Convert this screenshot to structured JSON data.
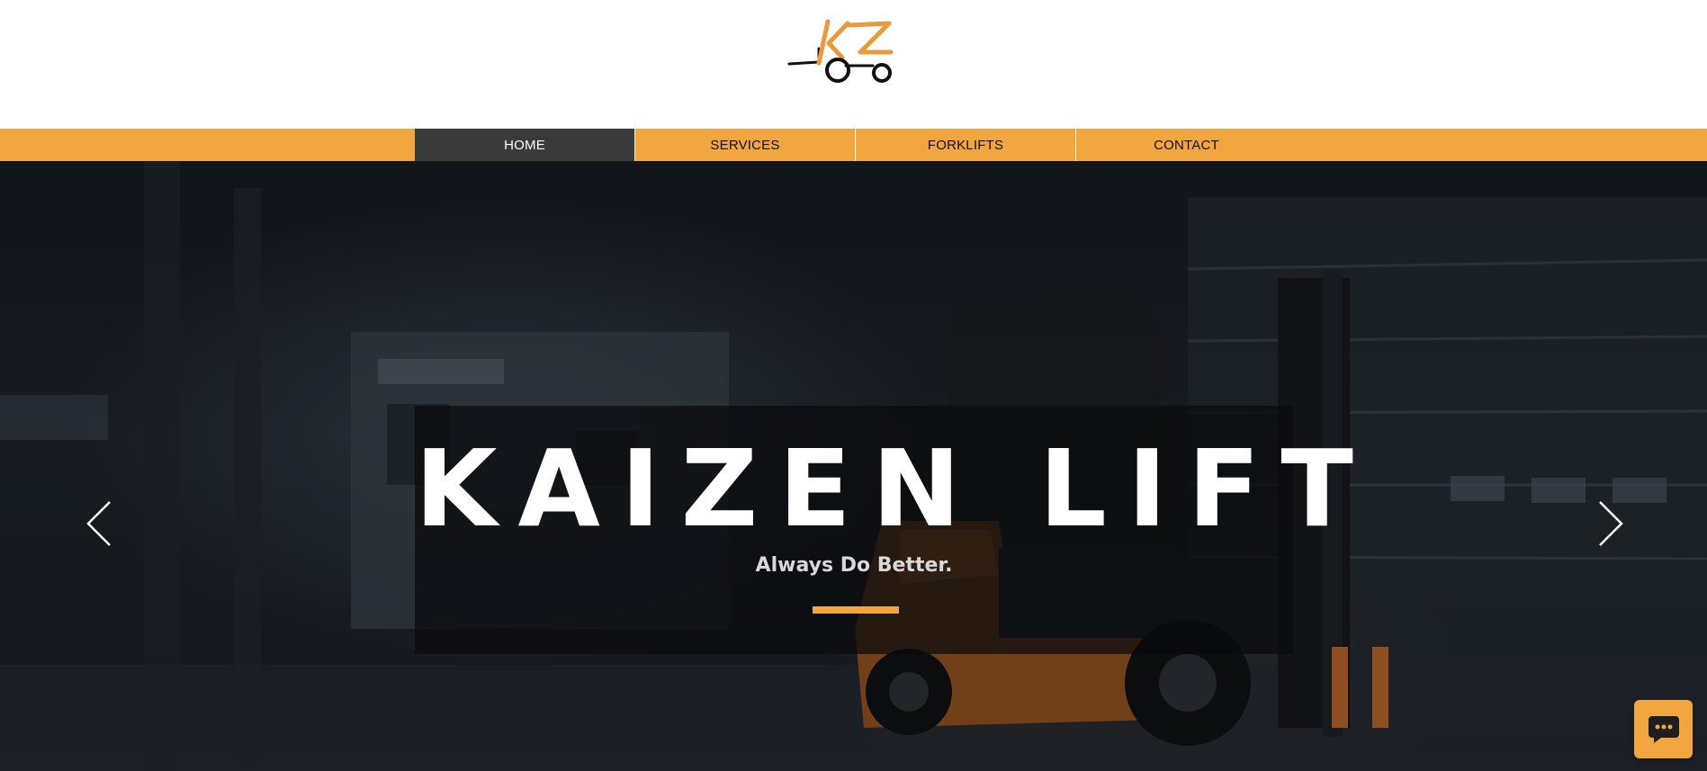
{
  "brand": {
    "logo_icon": "forklift-kz-logo-icon",
    "accent_color": "#f1a640"
  },
  "nav": {
    "items": [
      {
        "label": "HOME",
        "active": true
      },
      {
        "label": "SERVICES",
        "active": false
      },
      {
        "label": "FORKLIFTS",
        "active": false
      },
      {
        "label": "CONTACT",
        "active": false
      }
    ]
  },
  "hero": {
    "title": "KAIZEN LIFT",
    "subtitle": "Always Do Better.",
    "prev_icon": "chevron-left-icon",
    "next_icon": "chevron-right-icon",
    "background": "dark warehouse with orange forklift"
  },
  "chat": {
    "icon": "chat-bubble-icon"
  }
}
